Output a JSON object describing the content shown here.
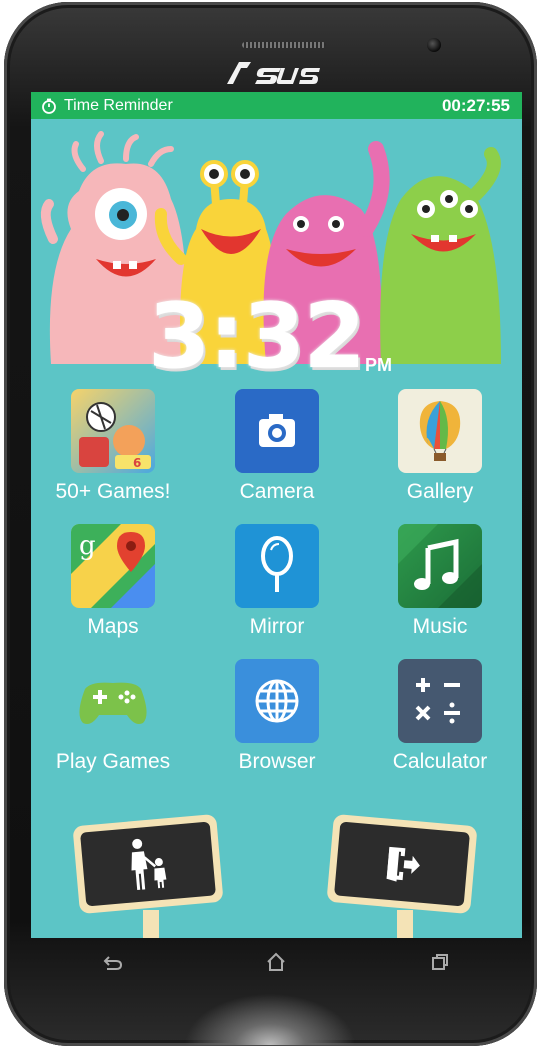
{
  "device": {
    "brand": "/ISUS"
  },
  "status": {
    "title": "Time Reminder",
    "countdown": "00:27:55"
  },
  "clock": {
    "time": "3:32",
    "ampm": "PM"
  },
  "apps": [
    {
      "label": "50+ Games!",
      "icon": "games-collage-icon"
    },
    {
      "label": "Camera",
      "icon": "camera-icon"
    },
    {
      "label": "Gallery",
      "icon": "balloon-icon"
    },
    {
      "label": "Maps",
      "icon": "maps-icon"
    },
    {
      "label": "Mirror",
      "icon": "mirror-icon"
    },
    {
      "label": "Music",
      "icon": "music-note-icon"
    },
    {
      "label": "Play Games",
      "icon": "gamepad-icon"
    },
    {
      "label": "Browser",
      "icon": "globe-icon"
    },
    {
      "label": "Calculator",
      "icon": "calculator-icon"
    }
  ],
  "colors": {
    "screen_bg": "#5cc5c6",
    "status_bar": "#21b35c",
    "sign_frame": "#f4e3b6",
    "sign_board": "#2c2c2c"
  },
  "nav": {
    "back": "back-icon",
    "home": "home-icon",
    "recents": "recents-icon"
  }
}
